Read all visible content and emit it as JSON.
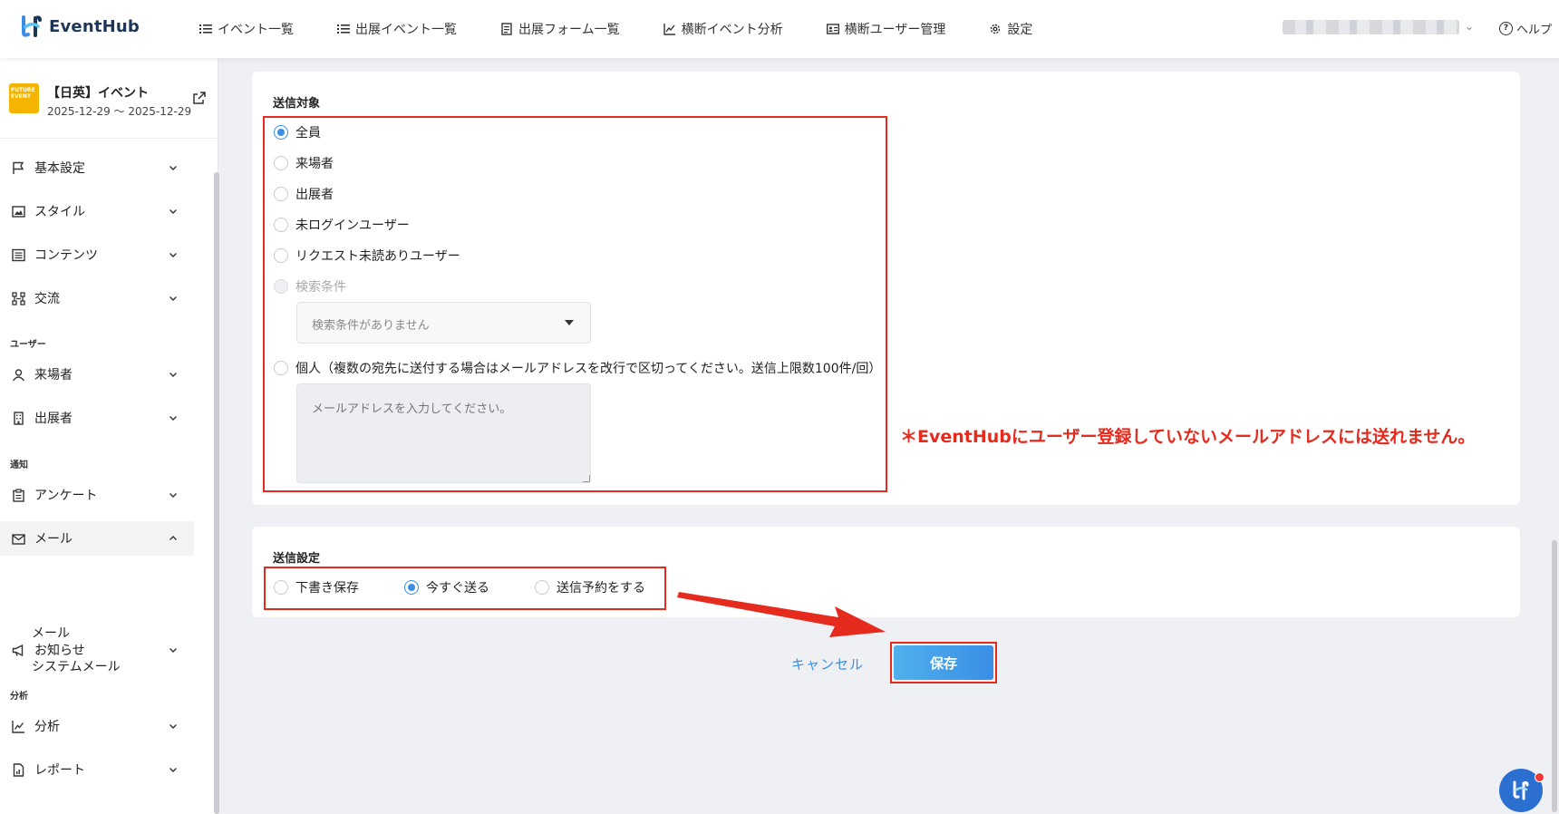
{
  "app": {
    "name": "EventHub"
  },
  "nav": {
    "items": [
      {
        "label": "イベント一覧",
        "icon": "list-icon"
      },
      {
        "label": "出展イベント一覧",
        "icon": "list-icon"
      },
      {
        "label": "出展フォーム一覧",
        "icon": "form-icon"
      },
      {
        "label": "横断イベント分析",
        "icon": "chart-icon"
      },
      {
        "label": "横断ユーザー管理",
        "icon": "id-card-icon"
      },
      {
        "label": "設定",
        "icon": "gear-icon"
      }
    ],
    "help_label": "ヘルプ"
  },
  "event": {
    "name": "【日英】イベント",
    "dates": "2025-12-29 ～ 2025-12-29",
    "thumb_text": "FUTURE EVENT"
  },
  "sidebar": {
    "items": [
      {
        "label": "基本設定",
        "icon": "flag-icon"
      },
      {
        "label": "スタイル",
        "icon": "image-icon"
      },
      {
        "label": "コンテンツ",
        "icon": "list-box-icon"
      },
      {
        "label": "交流",
        "icon": "network-icon"
      },
      {
        "label": "来場者",
        "icon": "user-icon"
      },
      {
        "label": "出展者",
        "icon": "building-icon"
      },
      {
        "label": "アンケート",
        "icon": "clipboard-icon"
      },
      {
        "label": "メール",
        "icon": "mail-icon"
      },
      {
        "label": "お知らせ",
        "icon": "megaphone-icon"
      },
      {
        "label": "分析",
        "icon": "chart-icon"
      },
      {
        "label": "レポート",
        "icon": "report-icon"
      }
    ],
    "sections": {
      "user": "ユーザー",
      "notice": "通知",
      "analysis": "分析"
    },
    "mail_sub": [
      "メール",
      "システムメール"
    ]
  },
  "recipients": {
    "title": "送信対象",
    "options": [
      "全員",
      "来場者",
      "出展者",
      "未ログインユーザー",
      "リクエスト未読ありユーザー",
      "検索条件",
      "個人（複数の宛先に送付する場合はメールアドレスを改行で区切ってください。送信上限数100件/回）"
    ],
    "selected": "全員",
    "search_select": "検索条件がありません",
    "email_placeholder": "メールアドレスを入力してください。"
  },
  "note": "＊EventHubにユーザー登録していないメールアドレスには送れません。",
  "send_settings": {
    "title": "送信設定",
    "options": [
      "下書き保存",
      "今すぐ送る",
      "送信予約をする"
    ],
    "selected": "今すぐ送る"
  },
  "actions": {
    "cancel": "キャンセル",
    "save": "保存"
  },
  "colors": {
    "accent": "#3a8ee6",
    "annotation": "#e52a1e",
    "brand": "#1d3557"
  }
}
